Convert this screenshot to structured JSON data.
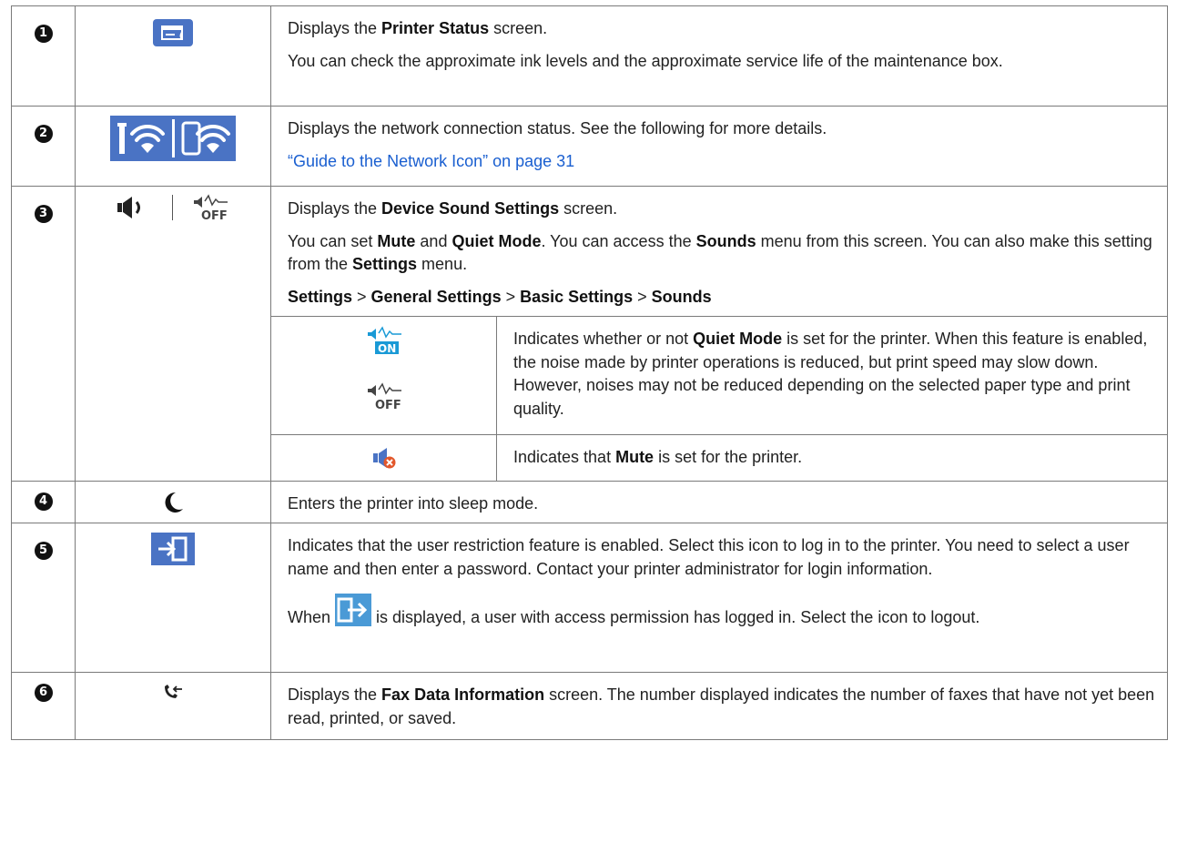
{
  "rows": [
    {
      "num": "1",
      "icon": "printer-status-icon",
      "p1_pre": "Displays the ",
      "p1_b": "Printer Status",
      "p1_post": " screen.",
      "p2": "You can check the approximate ink levels and the approximate service life of the maintenance box."
    },
    {
      "num": "2",
      "icon": "network-status-icon",
      "p1": "Displays the network connection status. See the following for more details.",
      "link": "“Guide to the Network Icon” on page 31"
    },
    {
      "num": "3",
      "icon": "sound-icon",
      "p1_pre": "Displays the ",
      "p1_b": "Device Sound Settings",
      "p1_post": " screen.",
      "p2_a": "You can set ",
      "p2_b1": "Mute",
      "p2_c": " and ",
      "p2_b2": "Quiet Mode",
      "p2_d": ". You can access the ",
      "p2_b3": "Sounds",
      "p2_e": " menu from this screen. You can also make this setting from the ",
      "p2_b4": "Settings",
      "p2_f": " menu.",
      "path": [
        "Settings",
        "General Settings",
        "Basic Settings",
        "Sounds"
      ],
      "path_sep": " > ",
      "sub": [
        {
          "icons": [
            "quiet-mode-on-icon",
            "quiet-mode-off-icon"
          ],
          "on_label": "ON",
          "off_label": "OFF",
          "t_a": "Indicates whether or not ",
          "t_b": "Quiet Mode",
          "t_c": " is set for the printer. When this feature is enabled, the noise made by printer operations is reduced, but print speed may slow down. However, noises may not be reduced depending on the selected paper type and print quality."
        },
        {
          "icons": [
            "mute-icon"
          ],
          "t_a": "Indicates that ",
          "t_b": "Mute",
          "t_c": " is set for the printer."
        }
      ]
    },
    {
      "num": "4",
      "icon": "sleep-icon",
      "p1": "Enters the printer into sleep mode."
    },
    {
      "num": "5",
      "icon": "login-icon",
      "p1": "Indicates that the user restriction feature is enabled. Select this icon to log in to the printer. You need to select a user name and then enter a password. Contact your printer administrator for login information.",
      "p2_a": "When ",
      "p2_b": " is displayed, a user with access permission has logged in. Select the icon to logout.",
      "inline_icon": "logout-icon"
    },
    {
      "num": "6",
      "icon": "fax-data-icon",
      "p1_pre": "Displays the ",
      "p1_b": "Fax Data Information",
      "p1_post": " screen. The number displayed indicates the number of faxes that have not yet been read, printed, or saved."
    }
  ],
  "colors": {
    "icon_blue": "#4a73c4",
    "link": "#1a5fd0",
    "quiet_on": "#1a9ad6"
  }
}
